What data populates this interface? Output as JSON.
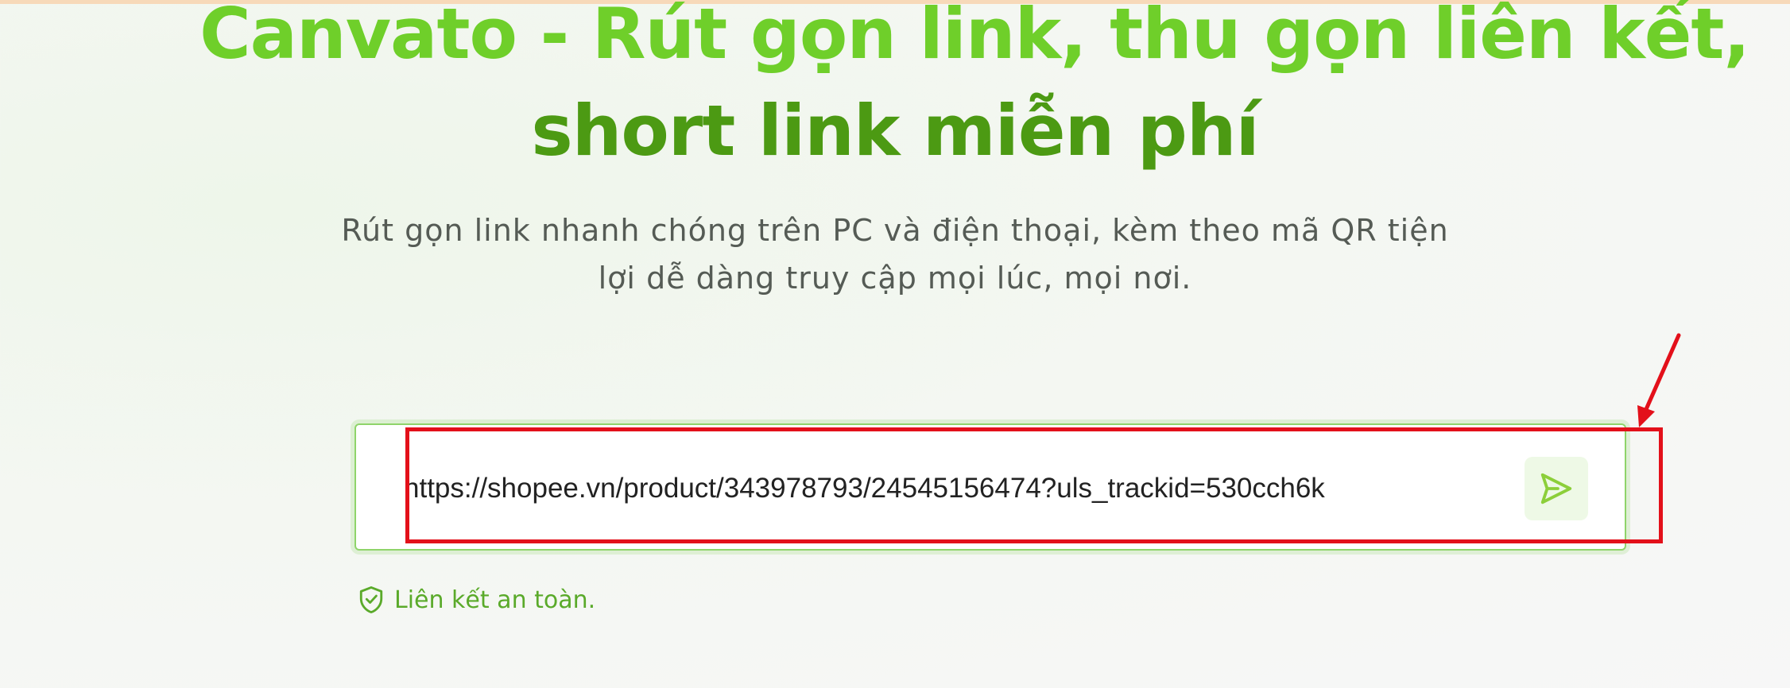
{
  "hero": {
    "title_line_1": "Canvato - Rút gọn link, thu gọn liên kết,",
    "title_line_2": "short link miễn phí",
    "subtitle_line_1": "Rút gọn link nhanh chóng trên PC và điện thoại, kèm theo mã QR tiện",
    "subtitle_line_2": "lợi dễ dàng truy cập mọi lúc, mọi nơi."
  },
  "shortener": {
    "url_value": "https://shopee.vn/product/343978793/24545156474?uls_trackid=530cch6k",
    "send_icon": "send-icon"
  },
  "safety": {
    "icon": "shield-check-icon",
    "text": "Liên kết an toàn."
  },
  "colors": {
    "title_light": "#6fcf2a",
    "title_dark": "#4c9a13",
    "accent": "#8fd46a",
    "annotation": "#e3101a",
    "safe_text": "#5aaa2a"
  }
}
